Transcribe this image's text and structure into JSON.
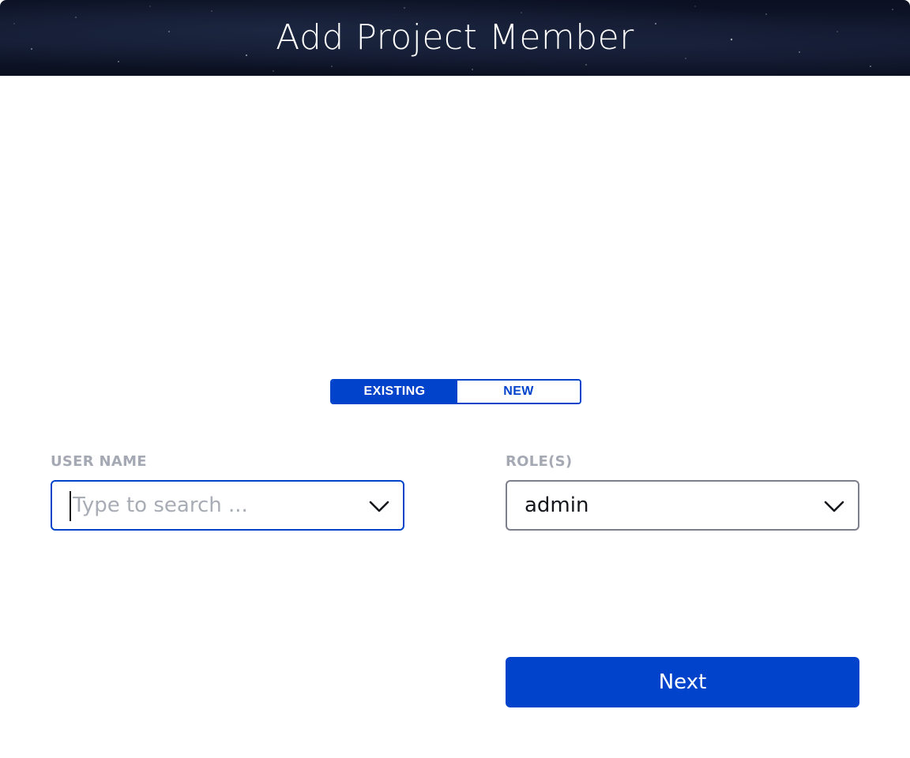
{
  "dialog": {
    "title": "Add Project Member"
  },
  "mode_toggle": {
    "options": [
      {
        "label": "EXISTING",
        "selected": true
      },
      {
        "label": "NEW",
        "selected": false
      }
    ]
  },
  "form": {
    "user_name": {
      "label": "USER NAME",
      "value": "",
      "placeholder": "Type to search ...",
      "icon": "chevron-down-icon"
    },
    "roles": {
      "label": "ROLE(S)",
      "value": "admin",
      "icon": "chevron-down-icon"
    }
  },
  "actions": {
    "next_label": "Next"
  },
  "colors": {
    "accent": "#0243cc",
    "label": "#a4a9b4",
    "header_bg": "#0f1629",
    "border_neutral": "#7d808a"
  }
}
